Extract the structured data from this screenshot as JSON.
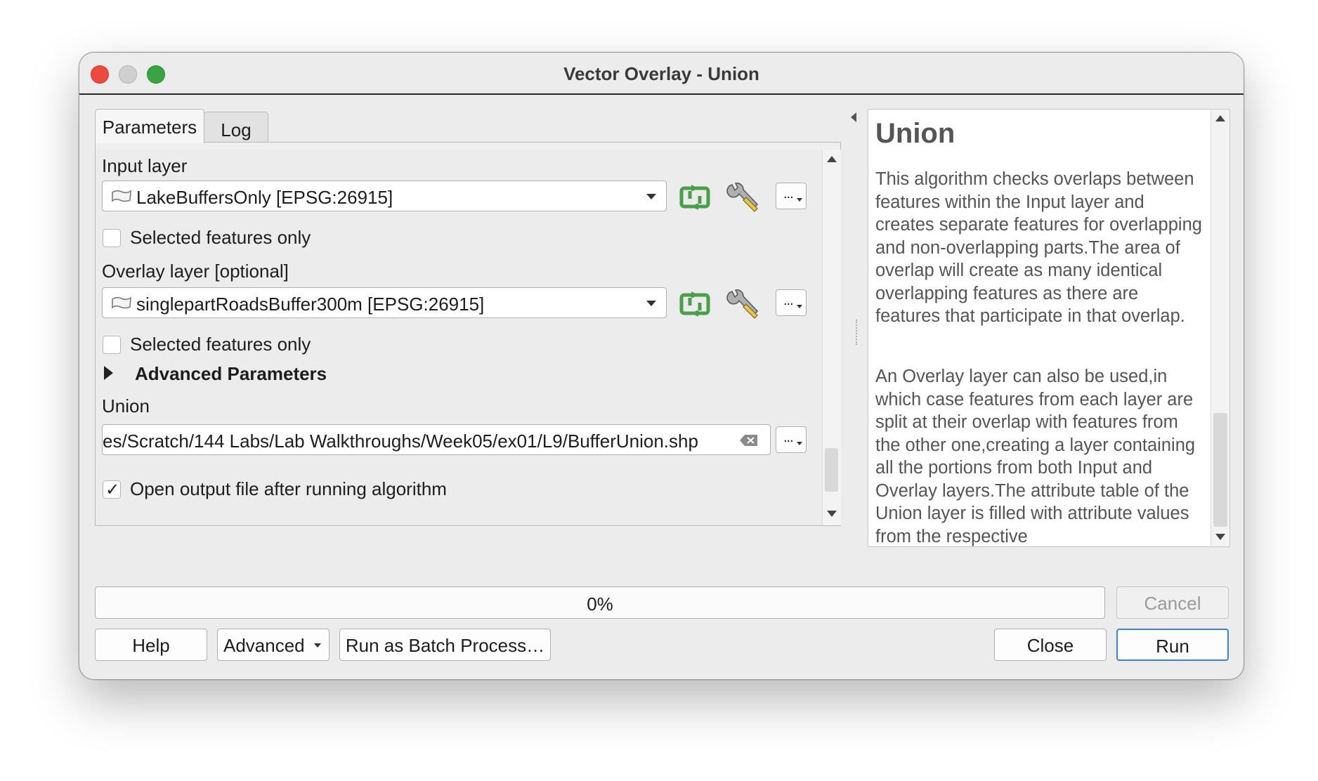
{
  "window": {
    "title": "Vector Overlay - Union"
  },
  "tabs": [
    {
      "label": "Parameters",
      "active": true
    },
    {
      "label": "Log",
      "active": false
    }
  ],
  "params": {
    "input_layer_label": "Input layer",
    "input_layer_value": "LakeBuffersOnly [EPSG:26915]",
    "input_selected_label": "Selected features only",
    "input_selected_checked": false,
    "overlay_layer_label": "Overlay layer [optional]",
    "overlay_layer_value": "singlepartRoadsBuffer300m [EPSG:26915]",
    "overlay_selected_label": "Selected features only",
    "overlay_selected_checked": false,
    "advanced_label": "Advanced Parameters",
    "output_label": "Union",
    "output_value": "es/Scratch/144 Labs/Lab Walkthroughs/Week05/ex01/L9/BufferUnion.shp",
    "open_output_label": "Open output file after running algorithm",
    "open_output_checked": true,
    "dots_label": "..."
  },
  "help": {
    "title": "Union",
    "para1": "This algorithm checks overlaps between features within the Input layer and creates separate features for overlapping and non-overlapping parts.The area of overlap will create as many identical overlapping features as there are features that participate in that overlap.",
    "para2": "An Overlay layer can also be used,in which case features from each layer are split at their overlap with features from the other one,creating a layer containing all the portions from both Input and Overlay layers.The attribute table of the Union layer is filled with attribute values from the respective"
  },
  "progress": {
    "value": 0,
    "label": "0%"
  },
  "buttons": {
    "help": "Help",
    "advanced": "Advanced",
    "batch": "Run as Batch Process…",
    "cancel": "Cancel",
    "close": "Close",
    "run": "Run"
  },
  "colors": {
    "accent": "#3b83d8",
    "icon_green": "#4aa04a",
    "close": "#ed4a3f",
    "zoom": "#3aa342"
  }
}
